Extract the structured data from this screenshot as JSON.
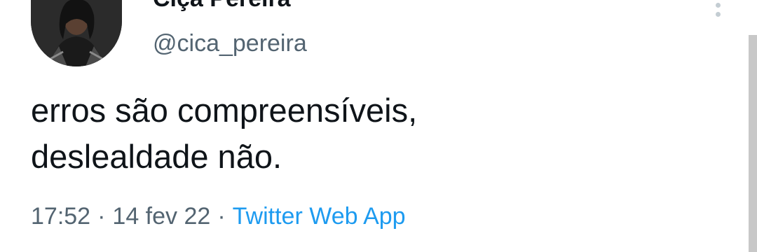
{
  "tweet": {
    "author": {
      "display_name": "Ciça Pereira",
      "handle": "@cica_pereira"
    },
    "text_lines": [
      "erros são compreensíveis,",
      "deslealdade não."
    ],
    "meta": {
      "time": "17:52",
      "separator": "·",
      "date": "14 fev 22",
      "source": "Twitter Web App"
    },
    "more_icon": "vertical-ellipsis-icon"
  },
  "colors": {
    "text": "#0f1419",
    "secondary": "#536471",
    "link": "#1d9bf0",
    "background": "#ffffff"
  }
}
